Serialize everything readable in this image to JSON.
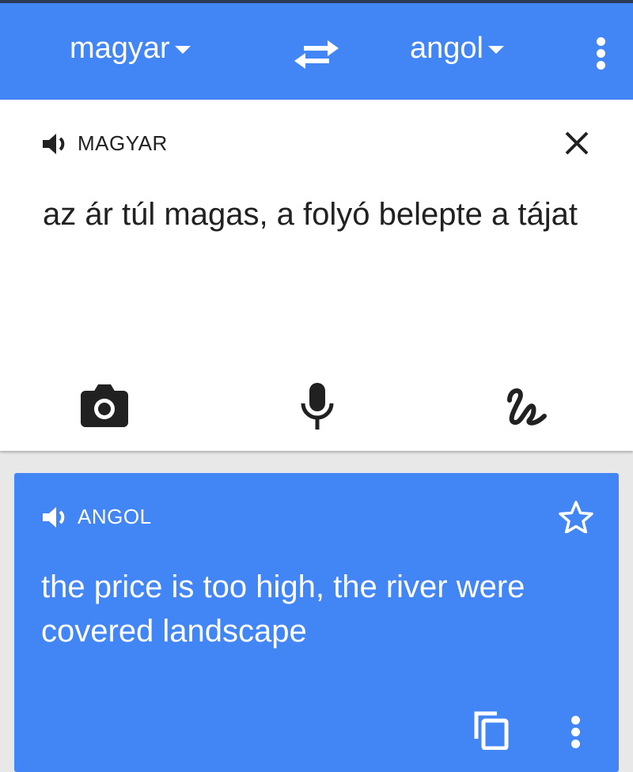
{
  "header": {
    "source_language": "magyar",
    "target_language": "angol",
    "swap_icon": "swap-arrows-icon",
    "menu_icon": "more-vert-icon"
  },
  "input_card": {
    "language_label": "MAGYAR",
    "text": "az ár túl magas, a folyó belepte a tájat",
    "tools": [
      "camera-icon",
      "microphone-icon",
      "handwriting-icon"
    ]
  },
  "output_card": {
    "language_label": "ANGOL",
    "text": "the price is too high, the river were covered landscape",
    "actions": [
      "star-icon",
      "copy-icon",
      "more-vert-icon"
    ]
  },
  "colors": {
    "accent": "#4285f4",
    "surface": "#ffffff",
    "background": "#e8e8e8",
    "text_dark": "#212121"
  }
}
